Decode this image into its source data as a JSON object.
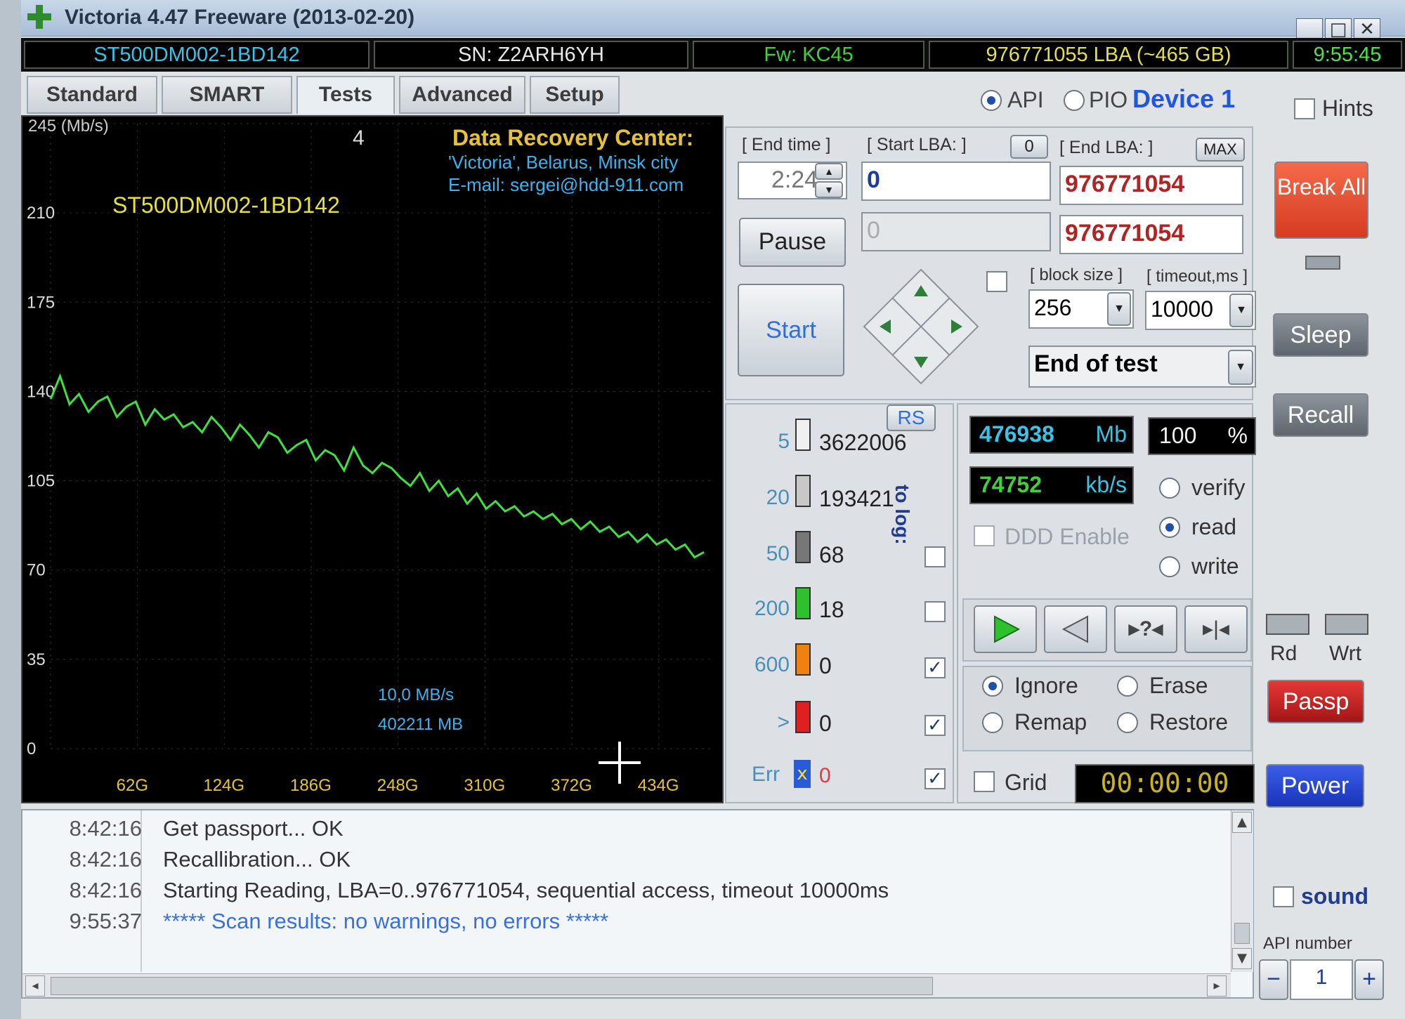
{
  "window": {
    "title": "Victoria 4.47  Freeware (2013-02-20)",
    "controls": [
      "_",
      "□",
      "✕"
    ]
  },
  "infobar": {
    "model": "ST500DM002-1BD142",
    "serial": "SN: Z2ARH6YH",
    "firmware": "Fw: KC45",
    "capacity": "976771055 LBA (~465 GB)",
    "clock": "9:55:45"
  },
  "tabs": [
    "Standard",
    "SMART",
    "Tests",
    "Advanced",
    "Setup"
  ],
  "mode": {
    "api": "API",
    "pio": "PIO",
    "device": "Device 1",
    "hints": "Hints"
  },
  "graph": {
    "yunit": "245 (Mb/s)",
    "counter": "4",
    "model": "ST500DM002-1BD142",
    "banner": [
      "Data Recovery Center:",
      "'Victoria', Belarus, Minsk city",
      "E-mail: sergei@hdd-911.com"
    ],
    "speed_readout": "10,0 MB/s",
    "mb_readout": "402211 MB"
  },
  "chart_data": {
    "type": "line",
    "xlabel": "",
    "ylabel": "",
    "ylim": [
      0,
      245
    ],
    "y_ticks": [
      "245 (Mb/s)",
      "210",
      "175",
      "140",
      "105",
      "70",
      "35",
      "0"
    ],
    "x_ticks": [
      "62G",
      "124G",
      "186G",
      "248G",
      "310G",
      "372G",
      "434G"
    ],
    "series": [
      {
        "values": [
          137,
          146,
          135,
          139,
          132,
          136,
          138,
          130,
          134,
          136,
          127,
          133,
          129,
          131,
          126,
          128,
          124,
          130,
          126,
          121,
          127,
          123,
          118,
          124,
          122,
          116,
          119,
          121,
          113,
          117,
          115,
          109,
          118,
          111,
          108,
          112,
          110,
          106,
          103,
          108,
          101,
          105,
          99,
          102,
          96,
          100,
          94,
          97,
          93,
          95,
          91,
          93,
          90,
          92,
          88,
          90,
          86,
          89,
          85,
          87,
          83,
          85,
          81,
          84,
          80,
          82,
          78,
          80,
          75,
          77
        ]
      }
    ]
  },
  "controls": {
    "end_time_label": "[ End time ]",
    "end_time_value": "2:24",
    "start_lba_label": "[ Start LBA: ]",
    "start_lba_zero_btn": "0",
    "start_lba_value": "0",
    "start_lba_current": "0",
    "end_lba_label": "[ End LBA: ]",
    "end_lba_max_btn": "MAX",
    "end_lba_value": "976771054",
    "end_lba_current": "976771054",
    "pause": "Pause",
    "start": "Start",
    "block_size_label": "[ block size ]",
    "block_size_value": "256",
    "timeout_label": "[ timeout,ms ]",
    "timeout_value": "10000",
    "end_action_value": "End of test"
  },
  "stats": {
    "rs": "RS",
    "to_log": "to log:",
    "rows": [
      {
        "label": "5",
        "count": "3622006",
        "color": "#c8c8c8"
      },
      {
        "label": "20",
        "count": "193421",
        "color": "#a8a8a8"
      },
      {
        "label": "50",
        "count": "68",
        "color": "#707070"
      },
      {
        "label": "200",
        "count": "18",
        "color": "#2ec12e"
      },
      {
        "label": "600",
        "count": "0",
        "color": "#f08010"
      },
      {
        "label": ">",
        "count": "0",
        "color": "#e02020"
      }
    ],
    "err_label": "Err",
    "err_count": "0"
  },
  "readouts": {
    "mb_value": "476938",
    "mb_unit": "Mb",
    "percent_value": "100",
    "percent_unit": "%",
    "speed_value": "74752",
    "speed_unit": "kb/s",
    "ddd": "DDD Enable",
    "verify": "verify",
    "read": "read",
    "write": "write",
    "ignore": "Ignore",
    "erase": "Erase",
    "remap": "Remap",
    "restore": "Restore",
    "grid": "Grid",
    "timer": "00:00:00"
  },
  "sidebar": {
    "break_all": "Break All",
    "sleep": "Sleep",
    "recall": "Recall",
    "rd": "Rd",
    "wrt": "Wrt",
    "passp": "Passp",
    "power": "Power",
    "sound": "sound",
    "api_number_label": "API number",
    "api_number_value": "1"
  },
  "log": [
    {
      "time": "8:42:16",
      "msg": "Get passport... OK",
      "highlight": false
    },
    {
      "time": "8:42:16",
      "msg": "Recallibration... OK",
      "highlight": false
    },
    {
      "time": "8:42:16",
      "msg": "Starting Reading, LBA=0..976771054, sequential access, timeout 10000ms",
      "highlight": false
    },
    {
      "time": "9:55:37",
      "msg": "***** Scan results: no warnings, no errors *****",
      "highlight": true
    }
  ]
}
